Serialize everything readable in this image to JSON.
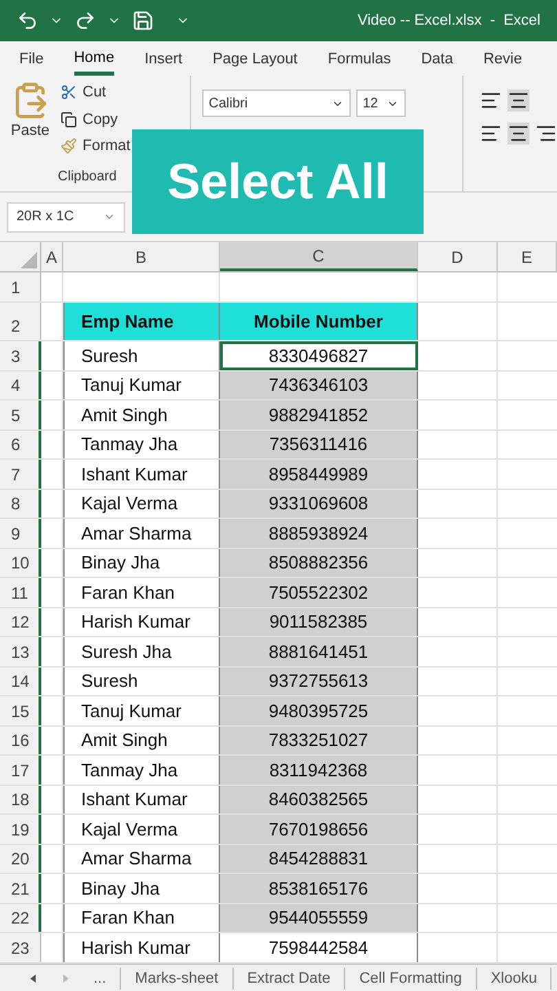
{
  "title_bar": {
    "title": "Video -- Excel.xlsx  -  Excel"
  },
  "ribbon_tabs": [
    {
      "label": "File",
      "selected": false
    },
    {
      "label": "Home",
      "selected": true
    },
    {
      "label": "Insert",
      "selected": false
    },
    {
      "label": "Page Layout",
      "selected": false
    },
    {
      "label": "Formulas",
      "selected": false
    },
    {
      "label": "Data",
      "selected": false
    },
    {
      "label": "Revie",
      "selected": false
    }
  ],
  "clipboard": {
    "paste": "Paste",
    "cut": "Cut",
    "copy": "Copy",
    "format": "Format",
    "group_label": "Clipboard"
  },
  "font": {
    "family": "Calibri",
    "size": "12"
  },
  "overlay": {
    "text": "Select All"
  },
  "name_box": {
    "value": "20R x 1C"
  },
  "columns": [
    {
      "label": "A",
      "selected": false
    },
    {
      "label": "B",
      "selected": false
    },
    {
      "label": "C",
      "selected": true
    },
    {
      "label": "D",
      "selected": false
    },
    {
      "label": "E",
      "selected": false
    }
  ],
  "blank_row": {
    "number": "1"
  },
  "header_row": {
    "number": "2",
    "name": "Emp Name",
    "mobile": "Mobile Number"
  },
  "rows": [
    {
      "number": "3",
      "name": "Suresh",
      "mobile": "8330496827",
      "selected": true,
      "active": true
    },
    {
      "number": "4",
      "name": "Tanuj Kumar",
      "mobile": "7436346103",
      "selected": true,
      "active": false
    },
    {
      "number": "5",
      "name": "Amit Singh",
      "mobile": "9882941852",
      "selected": true,
      "active": false
    },
    {
      "number": "6",
      "name": "Tanmay Jha",
      "mobile": "7356311416",
      "selected": true,
      "active": false
    },
    {
      "number": "7",
      "name": "Ishant Kumar",
      "mobile": "8958449989",
      "selected": true,
      "active": false
    },
    {
      "number": "8",
      "name": "Kajal Verma",
      "mobile": "9331069608",
      "selected": true,
      "active": false
    },
    {
      "number": "9",
      "name": "Amar Sharma",
      "mobile": "8885938924",
      "selected": true,
      "active": false
    },
    {
      "number": "10",
      "name": "Binay Jha",
      "mobile": "8508882356",
      "selected": true,
      "active": false
    },
    {
      "number": "11",
      "name": "Faran Khan",
      "mobile": "7505522302",
      "selected": true,
      "active": false
    },
    {
      "number": "12",
      "name": "Harish Kumar",
      "mobile": "9011582385",
      "selected": true,
      "active": false
    },
    {
      "number": "13",
      "name": "Suresh Jha",
      "mobile": "8881641451",
      "selected": true,
      "active": false
    },
    {
      "number": "14",
      "name": "Suresh",
      "mobile": "9372755613",
      "selected": true,
      "active": false
    },
    {
      "number": "15",
      "name": "Tanuj Kumar",
      "mobile": "9480395725",
      "selected": true,
      "active": false
    },
    {
      "number": "16",
      "name": "Amit Singh",
      "mobile": "7833251027",
      "selected": true,
      "active": false
    },
    {
      "number": "17",
      "name": "Tanmay Jha",
      "mobile": "8311942368",
      "selected": true,
      "active": false
    },
    {
      "number": "18",
      "name": "Ishant Kumar",
      "mobile": "8460382565",
      "selected": true,
      "active": false
    },
    {
      "number": "19",
      "name": "Kajal Verma",
      "mobile": "7670198656",
      "selected": true,
      "active": false
    },
    {
      "number": "20",
      "name": "Amar Sharma",
      "mobile": "8454288831",
      "selected": true,
      "active": false
    },
    {
      "number": "21",
      "name": "Binay Jha",
      "mobile": "8538165176",
      "selected": true,
      "active": false
    },
    {
      "number": "22",
      "name": "Faran Khan",
      "mobile": "9544055559",
      "selected": true,
      "active": false
    },
    {
      "number": "23",
      "name": "Harish Kumar",
      "mobile": "7598442584",
      "selected": false,
      "active": false
    }
  ],
  "sheet_tabs": {
    "more": "...",
    "tabs": [
      {
        "label": "Marks-sheet",
        "selected": false
      },
      {
        "label": "Extract Date",
        "selected": false
      },
      {
        "label": "Cell Formatting",
        "selected": false
      },
      {
        "label": "Xlooku",
        "selected": false
      }
    ]
  }
}
